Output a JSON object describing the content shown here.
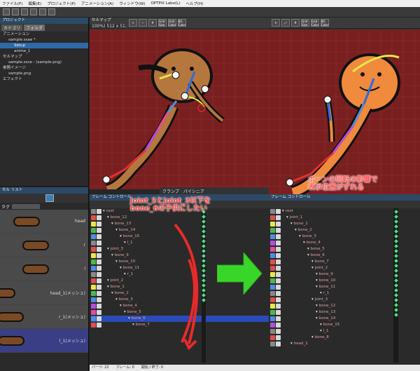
{
  "menu": [
    "ファイル(F)",
    "編集(E)",
    "プロジェクト(P)",
    "アニメーション(A)",
    "ウィンドウ(W)",
    "OPTPiX Labo(L)",
    "ヘルプ(H)"
  ],
  "project": {
    "title": "プロジェクト",
    "tabs": [
      "カテゴリ",
      "フォルダ"
    ],
    "rows": [
      {
        "label": "アニメーション",
        "depth": 0
      },
      {
        "label": "sample.ssae *",
        "depth": 1
      },
      {
        "label": "Setup",
        "depth": 2,
        "selected": true
      },
      {
        "label": "anime_1",
        "depth": 2
      },
      {
        "label": "セルマップ",
        "depth": 0
      },
      {
        "label": "sample.ssce - (sample.png)",
        "depth": 1
      },
      {
        "label": "参照イメージ",
        "depth": 0
      },
      {
        "label": "sample.png",
        "depth": 1
      },
      {
        "label": "エフェクト",
        "depth": 0
      }
    ]
  },
  "cellmap": {
    "title": "セルマップ",
    "size": "100%) 512 x 512"
  },
  "viewport": {
    "buttons": [
      "Grid Size",
      "Grid Color",
      "BG Color"
    ],
    "bottom_tabs": [
      "クランプ",
      "パイシニア"
    ],
    "tabs_right": "• Tab"
  },
  "cell_list": {
    "title": "セル リスト",
    "tag_label": "タグ",
    "items": [
      {
        "label": "head",
        "selected": false
      },
      {
        "label": "r",
        "selected": false
      },
      {
        "label": "l",
        "selected": false
      },
      {
        "label": "head_1(メッシュ)",
        "selected": false
      },
      {
        "label": "r_1(メッシュ)",
        "selected": false
      },
      {
        "label": "l_1(メッシュ)",
        "selected": true
      }
    ]
  },
  "frame_left": {
    "title": "フレーム コントロール",
    "rows": [
      {
        "name": "root",
        "depth": 0,
        "color": "#888888"
      },
      {
        "name": "bone_12",
        "depth": 1,
        "color": "#e24d4d"
      },
      {
        "name": "bone_13",
        "depth": 2,
        "color": "#e8e84a"
      },
      {
        "name": "bone_14",
        "depth": 3,
        "color": "#4db84d"
      },
      {
        "name": "bone_15",
        "depth": 4,
        "color": "#4d8fe2"
      },
      {
        "name": "l_1",
        "depth": 5,
        "color": "#888888"
      },
      {
        "name": "joint_3",
        "depth": 1,
        "color": "#e24d4d"
      },
      {
        "name": "bone_9",
        "depth": 2,
        "color": "#e8e84a"
      },
      {
        "name": "bone_10",
        "depth": 3,
        "color": "#4db84d"
      },
      {
        "name": "bone_11",
        "depth": 4,
        "color": "#4d8fe2"
      },
      {
        "name": "r_1",
        "depth": 5,
        "color": "#888888"
      },
      {
        "name": "joint_2",
        "depth": 1,
        "color": "#e24d4d"
      },
      {
        "name": "bone_1",
        "depth": 1,
        "color": "#e8e84a"
      },
      {
        "name": "bone_2",
        "depth": 2,
        "color": "#4db84d"
      },
      {
        "name": "bone_3",
        "depth": 3,
        "color": "#4d8fe2"
      },
      {
        "name": "bone_4",
        "depth": 4,
        "color": "#b34de2"
      },
      {
        "name": "bone_5",
        "depth": 5,
        "color": "#e24d9a"
      },
      {
        "name": "bone_6",
        "depth": 6,
        "color": "#4d8fe2",
        "selected": true
      },
      {
        "name": "bone_7",
        "depth": 7,
        "color": "#e24d4d"
      }
    ]
  },
  "frame_right": {
    "title": "フレーム コントロール",
    "rows": [
      {
        "name": "root",
        "depth": 0,
        "color": "#888888"
      },
      {
        "name": "joint_1",
        "depth": 1,
        "color": "#e24d4d"
      },
      {
        "name": "bone_1",
        "depth": 2,
        "color": "#e8e84a"
      },
      {
        "name": "bone_2",
        "depth": 3,
        "color": "#4db84d"
      },
      {
        "name": "bone_3",
        "depth": 4,
        "color": "#4d8fe2"
      },
      {
        "name": "bone_4",
        "depth": 5,
        "color": "#b34de2"
      },
      {
        "name": "bone_5",
        "depth": 6,
        "color": "#e24d9a"
      },
      {
        "name": "bone_6",
        "depth": 6,
        "color": "#4d8fe2"
      },
      {
        "name": "bone_7",
        "depth": 7,
        "color": "#e24d4d"
      },
      {
        "name": "joint_2",
        "depth": 7,
        "color": "#e24d4d"
      },
      {
        "name": "bone_9",
        "depth": 8,
        "color": "#e8e84a"
      },
      {
        "name": "bone_10",
        "depth": 8,
        "color": "#4db84d"
      },
      {
        "name": "bone_11",
        "depth": 8,
        "color": "#4d8fe2"
      },
      {
        "name": "r_1",
        "depth": 9,
        "color": "#888888"
      },
      {
        "name": "joint_3",
        "depth": 7,
        "color": "#e24d4d"
      },
      {
        "name": "bone_12",
        "depth": 8,
        "color": "#e8e84a"
      },
      {
        "name": "bone_13",
        "depth": 8,
        "color": "#4db84d"
      },
      {
        "name": "bone_14",
        "depth": 8,
        "color": "#4d8fe2"
      },
      {
        "name": "bone_15",
        "depth": 9,
        "color": "#b34de2"
      },
      {
        "name": "l_1",
        "depth": 9,
        "color": "#888888"
      },
      {
        "name": "bone_8",
        "depth": 7,
        "color": "#e24d4d"
      },
      {
        "name": "head_1",
        "depth": 2,
        "color": "#888888"
      }
    ]
  },
  "annotations": {
    "left_line1": "joint_2とjoint_3以下を",
    "left_line2": "bone_6の子供にしたい",
    "right_line1": "ボーンの回転の影響で",
    "right_line2": "表示位置がずれる"
  },
  "status": {
    "parts": "パーツ: 22",
    "frame": "フレーム: 0",
    "start_end": "開始 / 終了: 0"
  },
  "colors": {
    "canvas": "#7a1f1f",
    "accent": "#2c4a66",
    "arrow": "#39d62a",
    "note": "#ff4040"
  }
}
